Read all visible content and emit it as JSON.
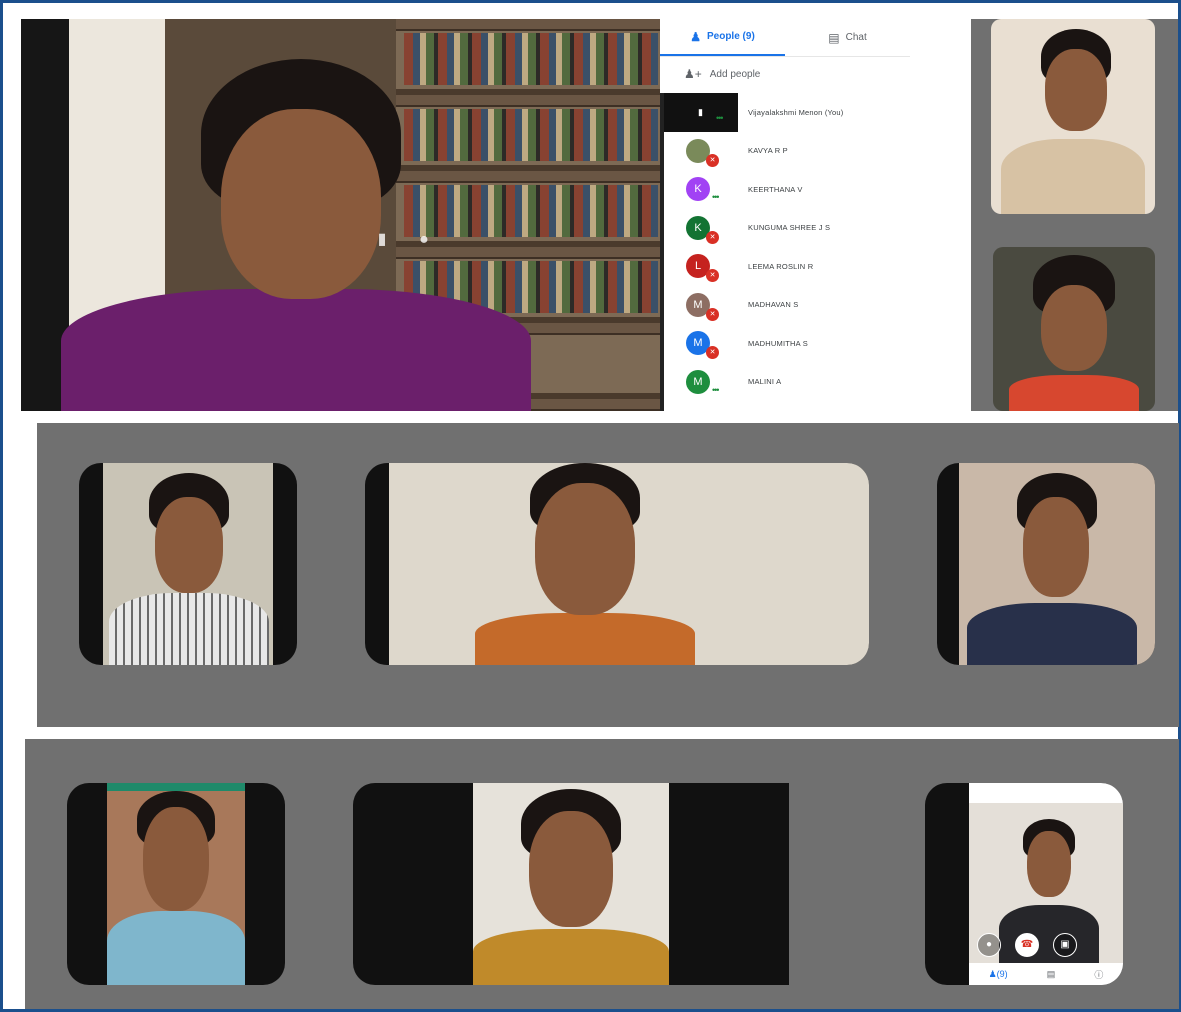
{
  "meeting": {
    "tabs": [
      {
        "label": "People (9)",
        "icon": "people-icon",
        "active": true
      },
      {
        "label": "Chat",
        "icon": "chat-icon",
        "active": false
      }
    ],
    "add_people_label": "Add people",
    "participants": [
      {
        "name": "Vijayalakshmi Menon (You)",
        "avatar_letter": "",
        "avatar_color": "#111111",
        "status": "pinned"
      },
      {
        "name": "KAVYA R P",
        "avatar_letter": "",
        "avatar_color": "#7a8a5a",
        "status": "muted"
      },
      {
        "name": "KEERTHANA V",
        "avatar_letter": "K",
        "avatar_color": "#a142f4",
        "status": "speaking"
      },
      {
        "name": "KUNGUMA SHREE J S",
        "avatar_letter": "K",
        "avatar_color": "#137333",
        "status": "muted"
      },
      {
        "name": "LEEMA ROSLIN R",
        "avatar_letter": "L",
        "avatar_color": "#c5221f",
        "status": "muted"
      },
      {
        "name": "MADHAVAN S",
        "avatar_letter": "M",
        "avatar_color": "#8d6e63",
        "status": "muted"
      },
      {
        "name": "MADHUMITHA S",
        "avatar_letter": "M",
        "avatar_color": "#1a73e8",
        "status": "muted"
      },
      {
        "name": "MALINI A",
        "avatar_letter": "M",
        "avatar_color": "#1e8e3e",
        "status": "speaking"
      }
    ]
  },
  "phone_ui": {
    "nav_people_label": "(9)"
  },
  "colors": {
    "frame_border": "#1b4f8c",
    "band_gray": "#707070",
    "accent": "#1a73e8",
    "mute_red": "#d93025"
  }
}
